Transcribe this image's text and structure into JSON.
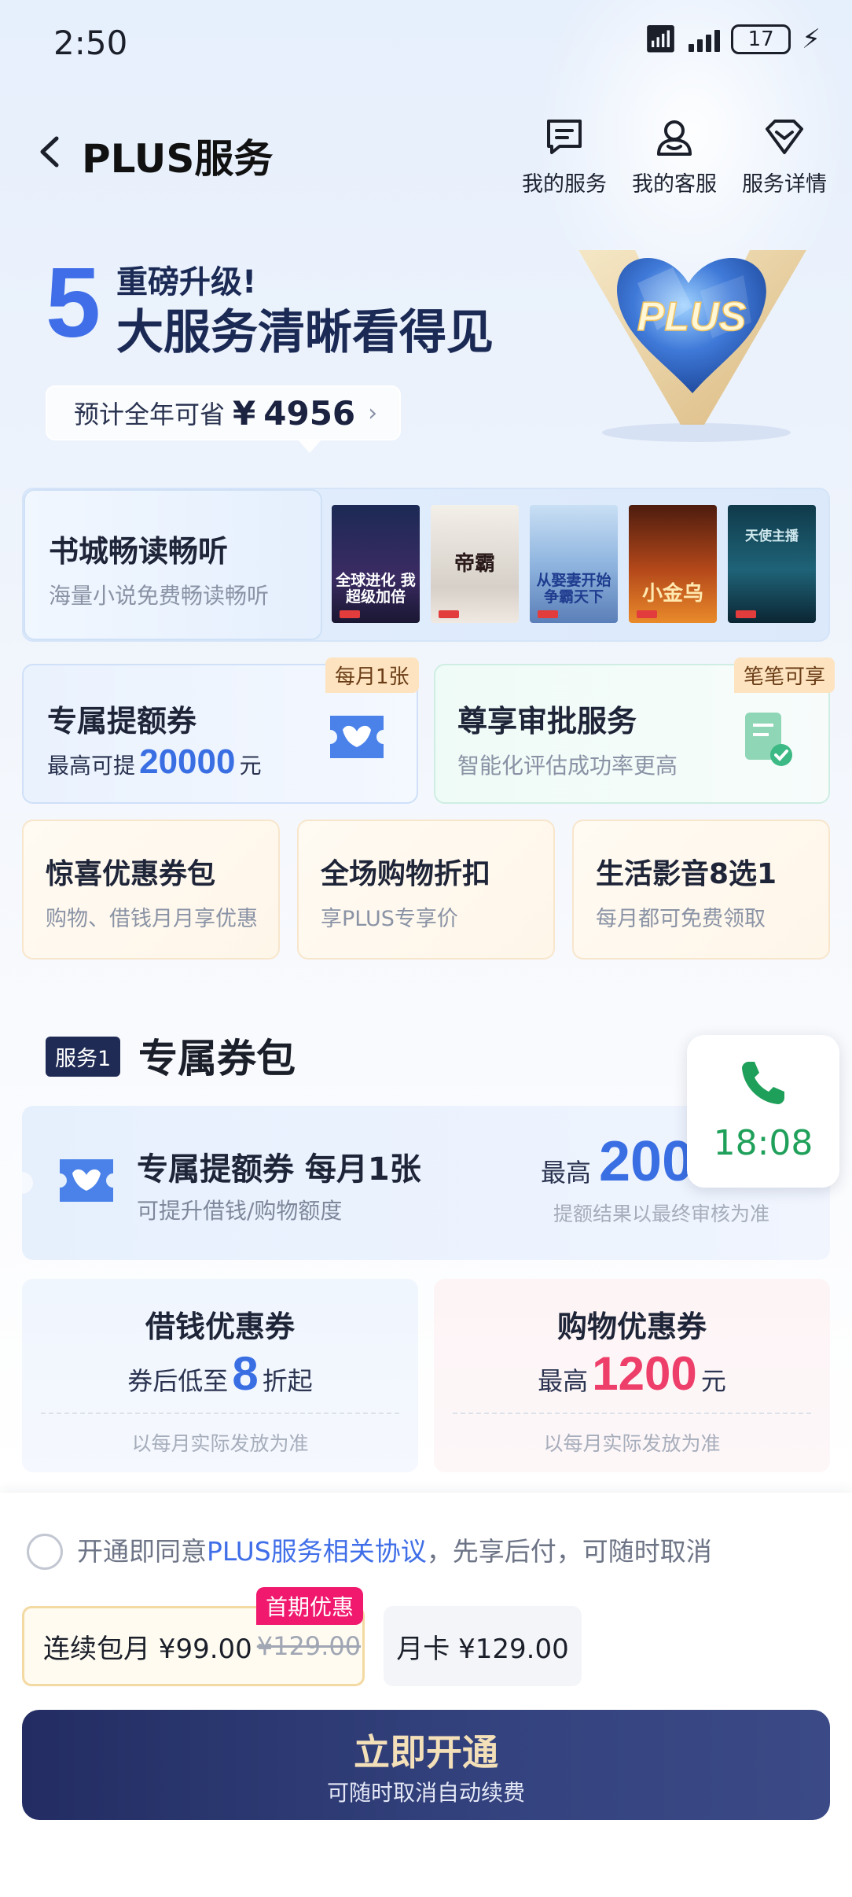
{
  "status_bar": {
    "time": "2:50",
    "network": "6",
    "battery": "17"
  },
  "header": {
    "title": "PLUS服务",
    "actions": [
      {
        "label": "我的服务",
        "icon": "service-list-icon"
      },
      {
        "label": "我的客服",
        "icon": "customer-service-icon"
      },
      {
        "label": "服务详情",
        "icon": "diamond-icon"
      }
    ]
  },
  "hero": {
    "number": "5",
    "line1": "重磅升级!",
    "line2": "大服务清晰看得见",
    "savings_label": "预计全年可省",
    "savings_currency": "¥",
    "savings_amount": "4956",
    "logo_text": "PLUS"
  },
  "book_card": {
    "title": "书城畅读畅听",
    "subtitle": "海量小说免费畅读畅听",
    "books": [
      {
        "title": "全球进化 我超级加倍"
      },
      {
        "title": "帝霸"
      },
      {
        "title": "从娶妻开始 争霸天下"
      },
      {
        "title": "小金乌"
      },
      {
        "title": "天使主播"
      }
    ]
  },
  "tiles": {
    "credit": {
      "title": "专属提额券",
      "prefix": "最高可提",
      "amount": "20000",
      "unit": "元",
      "tag": "每月1张"
    },
    "approval": {
      "title": "尊享审批服务",
      "subtitle": "智能化评估成功率更高",
      "tag": "笔笔可享"
    },
    "coupon_pack": {
      "title": "惊喜优惠券包",
      "subtitle": "购物、借钱月月享优惠"
    },
    "discount": {
      "title": "全场购物折扣",
      "subtitle": "享PLUS专享价"
    },
    "life": {
      "title": "生活影音8选1",
      "subtitle": "每月都可免费领取"
    }
  },
  "section1": {
    "badge": "服务1",
    "title": "专属券包",
    "main_coupon": {
      "title": "专属提额券 每月1张",
      "subtitle": "可提升借钱/购物额度",
      "prefix": "最高",
      "amount": "200",
      "note": "提额结果以最终审核为准"
    },
    "loan_coupon": {
      "title": "借钱优惠券",
      "prefix": "券后低至",
      "value": "8",
      "suffix": "折起",
      "note": "以每月实际发放为准"
    },
    "shopping_coupon": {
      "title": "购物优惠券",
      "prefix": "最高",
      "value": "1200",
      "suffix": "元",
      "note": "以每月实际发放为准"
    }
  },
  "call_widget": {
    "time": "18:08"
  },
  "bottom": {
    "agree_prefix": "开通即同意",
    "agree_link": "PLUS服务相关协议",
    "agree_suffix": "，先享后付，可随时取消",
    "plans": [
      {
        "label": "连续包月 ¥99.00",
        "original": "¥129.00",
        "tag": "首期优惠",
        "selected": true
      },
      {
        "label": "月卡 ¥129.00",
        "selected": false
      }
    ],
    "cta_main": "立即开通",
    "cta_sub": "可随时取消自动续费"
  }
}
